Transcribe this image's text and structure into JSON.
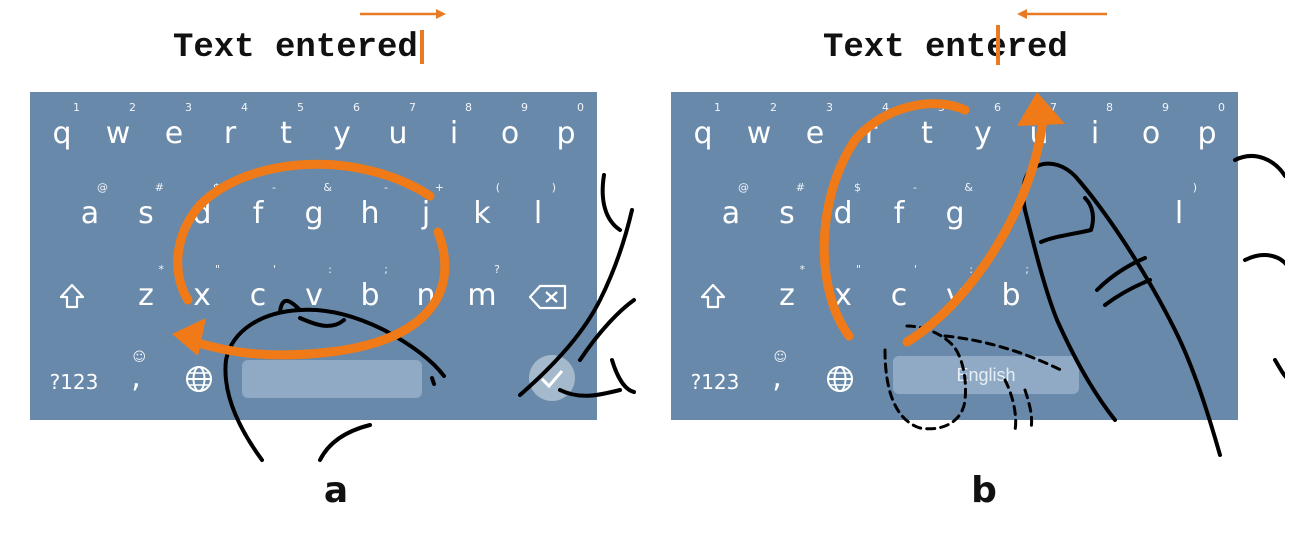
{
  "panels": [
    {
      "id": "a",
      "text_entered": "Text entered",
      "label": "a",
      "keyboard": {
        "rows": [
          [
            [
              "q",
              "1"
            ],
            [
              "w",
              "2"
            ],
            [
              "e",
              "3"
            ],
            [
              "r",
              "4"
            ],
            [
              "t",
              "5"
            ],
            [
              "y",
              "6"
            ],
            [
              "u",
              "7"
            ],
            [
              "i",
              "8"
            ],
            [
              "o",
              "9"
            ],
            [
              "p",
              "0"
            ]
          ],
          [
            [
              "a",
              "@"
            ],
            [
              "s",
              "#"
            ],
            [
              "d",
              "$"
            ],
            [
              "f",
              "-"
            ],
            [
              "g",
              "&"
            ],
            [
              "h",
              "-"
            ],
            [
              "j",
              "+"
            ],
            [
              "k",
              "("
            ],
            [
              "l",
              ")"
            ]
          ],
          [
            [
              "x",
              "\""
            ],
            [
              "c",
              "'"
            ],
            [
              "v",
              ":"
            ],
            [
              "b",
              ";"
            ],
            [
              "n",
              "!"
            ],
            [
              "m",
              "?"
            ]
          ],
          [
            [
              "z",
              "*"
            ]
          ]
        ],
        "num_key": "?123",
        "comma_key": ",",
        "emoji_hint": "☺",
        "space_label": ""
      }
    },
    {
      "id": "b",
      "text_entered": "Text entered",
      "label": "b",
      "keyboard": {
        "num_key": "?123",
        "comma_key": ",",
        "emoji_hint": "☺",
        "space_label": "English"
      }
    }
  ],
  "colors": {
    "keyboard": "#6889aa",
    "gesture": "#f07a17",
    "caret": "#e87a24"
  },
  "icons": [
    "shift-icon",
    "backspace-icon",
    "globe-icon",
    "check-icon",
    "emoji-icon",
    "hand-sketch"
  ]
}
